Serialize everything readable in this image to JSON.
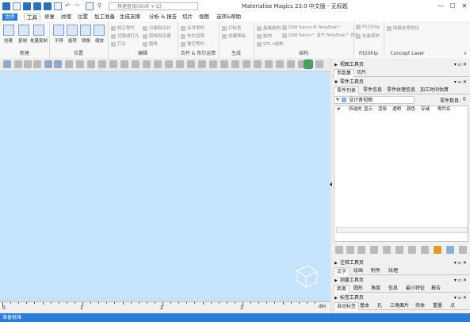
{
  "window": {
    "title": "Materialise Magics 23.0 中文版 - 无标题",
    "search_placeholder": "快速查找(Shift + Q)",
    "controls": [
      "—",
      "☐",
      "✕"
    ]
  },
  "menu": [
    "文件",
    "工具",
    "修复",
    "纹理",
    "位置",
    "加工准备",
    "生成支撑",
    "分析 & 报告",
    "切片",
    "视图",
    "选项&帮助"
  ],
  "ribbon": {
    "groups": [
      {
        "label": "新建",
        "items": [
          "创建",
          "复制",
          "批量复制"
        ]
      },
      {
        "label": "位置",
        "items": [
          "平移",
          "旋转",
          "镜像",
          "缩放"
        ]
      },
      {
        "label": "编辑",
        "items": [
          "修正零件",
          "切割或打孔",
          "打孔",
          "分离和合并",
          "剪枝和压缩",
          "圆角"
        ]
      },
      {
        "label": "合并 & 布尔运算",
        "items": [
          "合并零件",
          "布尔运算",
          "镂空零件"
        ]
      },
      {
        "label": "生成",
        "items": [
          "打标签",
          "创建面板"
        ]
      },
      {
        "label": "结构",
        "items": [
          "晶格结构",
          "结构",
          "STL+结构",
          "DSM Sonics 中 TetraShell™",
          "DSM Sonics™ 基于 TetraShell™ 优化"
        ]
      },
      {
        "label": "Fit2Ship",
        "items": [
          "Fit2Ship",
          "包装保护"
        ]
      },
      {
        "label": "Concept Laser",
        "items": [
          "网格支撑优化"
        ]
      }
    ]
  },
  "viewport": {
    "background": "#c5e4fb",
    "ruler_labels": [
      "0",
      "1",
      "2",
      "3"
    ],
    "ruler_unit": "dm"
  },
  "status": "准备就绪",
  "right_panel": {
    "view_toolpage": {
      "title": "视图工具页",
      "tabs": [
        "参数集",
        "切片"
      ]
    },
    "part_toolpage": {
      "title": "零件工具页",
      "tabs": [
        "零件列表",
        "零件信息",
        "零件纹理信息",
        "加工时间估算"
      ],
      "scene_label": "设计者视图",
      "part_count_label": "零件数目:",
      "part_count": "0",
      "columns": [
        "#",
        "所选的",
        "显示",
        "渲染",
        "透明",
        "颜色",
        "存储",
        "零件名"
      ]
    },
    "annotation_toolpage": {
      "title": "注释工具页",
      "tabs": [
        "文字",
        "绘画",
        "附件",
        "纹理"
      ]
    },
    "measure_toolpage": {
      "title": "测量工具页",
      "tabs": [
        "距离",
        "圆形",
        "角度",
        "信息",
        "最小特征",
        "报告"
      ]
    },
    "label_toolpage": {
      "title": "标签工具页",
      "tabs": [
        "自动标签",
        "基本",
        "孔",
        "三角面片",
        "壳体",
        "重量",
        "点"
      ]
    }
  },
  "colors": {
    "accent": "#2b7bd8",
    "viewport": "#c5e4fb",
    "statusbar": "#2b7bd8"
  }
}
